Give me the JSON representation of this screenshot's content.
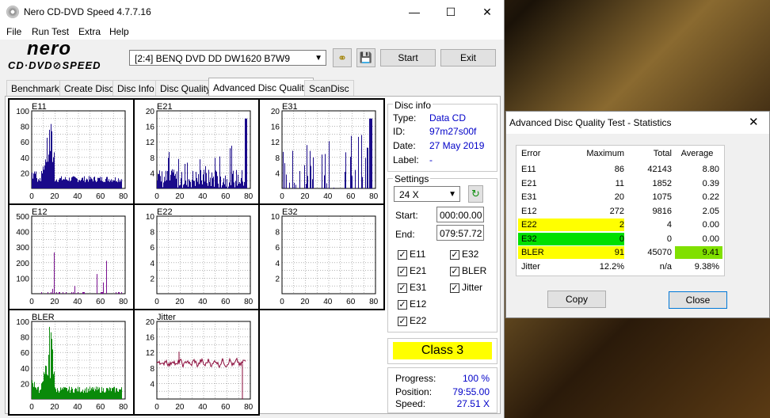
{
  "app": {
    "title": "Nero CD-DVD Speed 4.7.7.16",
    "logo_line1": "nero",
    "logo_line2": "CD·DVD⊘SPEED",
    "menu": [
      "File",
      "Run Test",
      "Extra",
      "Help"
    ],
    "drive": "[2:4]   BENQ DVD DD DW1620 B7W9",
    "start_label": "Start",
    "exit_label": "Exit",
    "tabs": [
      "Benchmark",
      "Create Disc",
      "Disc Info",
      "Disc Quality",
      "Advanced Disc Quality",
      "ScanDisc"
    ],
    "active_tab": 4
  },
  "disc_info": {
    "header": "Disc info",
    "type_label": "Type:",
    "type": "Data CD",
    "id_label": "ID:",
    "id": "97m27s00f",
    "date_label": "Date:",
    "date": "27 May 2019",
    "label_label": "Label:",
    "label": "-"
  },
  "settings": {
    "header": "Settings",
    "speed": "24 X",
    "start_label": "Start:",
    "start": "000:00.00",
    "end_label": "End:",
    "end": "079:57.72",
    "checks": [
      {
        "label": "E11",
        "checked": true
      },
      {
        "label": "E32",
        "checked": true
      },
      {
        "label": "E21",
        "checked": true
      },
      {
        "label": "BLER",
        "checked": true
      },
      {
        "label": "E31",
        "checked": true
      },
      {
        "label": "Jitter",
        "checked": true
      },
      {
        "label": "E12",
        "checked": true
      },
      {
        "label": "E22",
        "checked": true
      }
    ]
  },
  "class_label": "Class 3",
  "progress": {
    "progress_label": "Progress:",
    "progress": "100 %",
    "position_label": "Position:",
    "position": "79:55.00",
    "speed_label": "Speed:",
    "speed": "27.51 X"
  },
  "charts": [
    {
      "name": "E11",
      "yticks": [
        "100",
        "80",
        "60",
        "40",
        "20"
      ],
      "color": "#1a0a8a",
      "fill": true
    },
    {
      "name": "E21",
      "yticks": [
        "20",
        "16",
        "12",
        "8",
        "4"
      ],
      "color": "#1a0a8a",
      "fill": true
    },
    {
      "name": "E31",
      "yticks": [
        "20",
        "16",
        "12",
        "8",
        "4"
      ],
      "color": "#1a0a8a",
      "fill": false
    },
    {
      "name": "E12",
      "yticks": [
        "500",
        "400",
        "300",
        "200",
        "100"
      ],
      "color": "#7a1090",
      "fill": false
    },
    {
      "name": "E22",
      "yticks": [
        "10",
        "8",
        "6",
        "4",
        "2"
      ],
      "color": "#7a1090",
      "fill": false
    },
    {
      "name": "E32",
      "yticks": [
        "10",
        "8",
        "6",
        "4",
        "2"
      ],
      "color": "#7a1090",
      "fill": false
    },
    {
      "name": "BLER",
      "yticks": [
        "100",
        "80",
        "60",
        "40",
        "20"
      ],
      "color": "#0a8a0a",
      "fill": true
    },
    {
      "name": "Jitter",
      "yticks": [
        "20",
        "16",
        "12",
        "8",
        "4"
      ],
      "color": "#8a0a3a",
      "fill": false
    }
  ],
  "xticks": [
    "0",
    "20",
    "40",
    "60",
    "80"
  ],
  "stats": {
    "title": "Advanced Disc Quality Test - Statistics",
    "headers": [
      "Error",
      "Maximum",
      "Total",
      "Average"
    ],
    "rows": [
      {
        "error": "E11",
        "max": "86",
        "total": "42143",
        "avg": "8.80",
        "hl": "",
        "avghl": ""
      },
      {
        "error": "E21",
        "max": "11",
        "total": "1852",
        "avg": "0.39",
        "hl": "",
        "avghl": ""
      },
      {
        "error": "E31",
        "max": "20",
        "total": "1075",
        "avg": "0.22",
        "hl": "",
        "avghl": ""
      },
      {
        "error": "E12",
        "max": "272",
        "total": "9816",
        "avg": "2.05",
        "hl": "",
        "avghl": ""
      },
      {
        "error": "E22",
        "max": "2",
        "total": "4",
        "avg": "0.00",
        "hl": "#ffff00",
        "avghl": ""
      },
      {
        "error": "E32",
        "max": "0",
        "total": "0",
        "avg": "0.00",
        "hl": "#00e000",
        "avghl": ""
      },
      {
        "error": "BLER",
        "max": "91",
        "total": "45070",
        "avg": "9.41",
        "hl": "#ffff00",
        "avghl": "#80e000"
      },
      {
        "error": "Jitter",
        "max": "12.2%",
        "total": "n/a",
        "avg": "9.38%",
        "hl": "",
        "avghl": ""
      }
    ],
    "copy_label": "Copy",
    "close_label": "Close"
  }
}
